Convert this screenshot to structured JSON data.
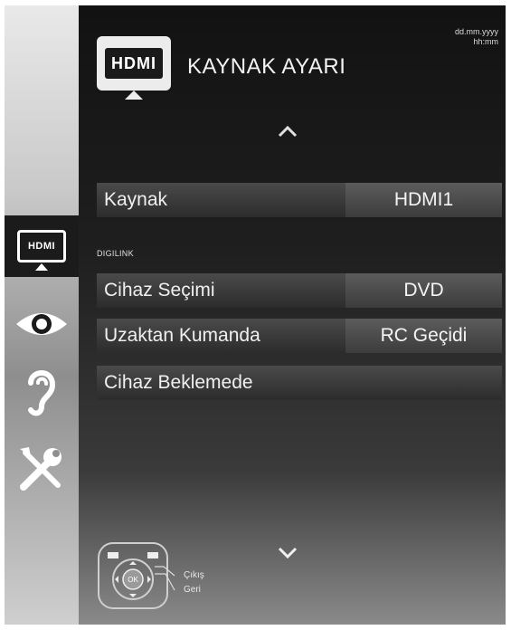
{
  "header": {
    "title": "KAYNAK AYARI",
    "date": "dd.mm.yyyy",
    "time": "hh:mm",
    "logo_text": "HDMI"
  },
  "sidebar": {
    "items": [
      {
        "name": "source",
        "icon": "hdmi-icon",
        "label": "HDMI",
        "active": true
      },
      {
        "name": "picture",
        "icon": "eye-icon",
        "active": false
      },
      {
        "name": "sound",
        "icon": "ear-icon",
        "active": false
      },
      {
        "name": "settings",
        "icon": "tools-icon",
        "active": false
      }
    ]
  },
  "menu": {
    "source_label": "Kaynak",
    "source_value": "HDMI1",
    "section_label": "DIGILINK",
    "device_label": "Cihaz Seçimi",
    "device_value": "DVD",
    "remote_label": "Uzaktan Kumanda",
    "remote_value": "RC Geçidi",
    "standby_label": "Cihaz Beklemede"
  },
  "footer": {
    "ok_label": "OK",
    "exit_label": "Çıkış",
    "back_label": "Geri"
  }
}
